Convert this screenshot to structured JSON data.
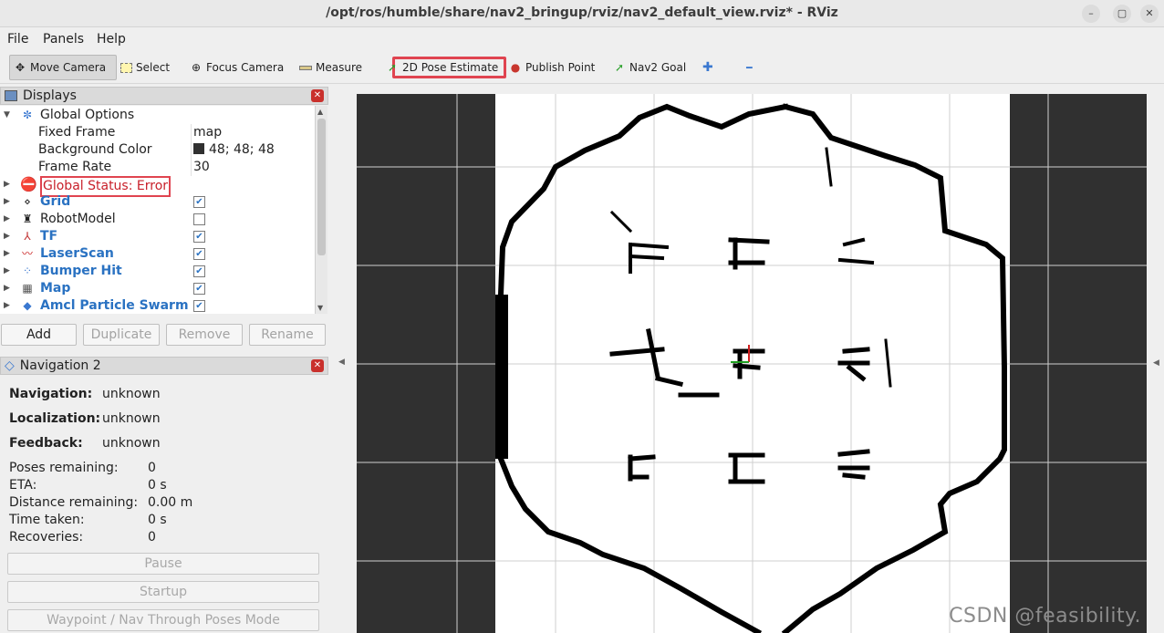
{
  "window": {
    "title": "/opt/ros/humble/share/nav2_bringup/rviz/nav2_default_view.rviz* - RViz",
    "minimize_glyph": "–",
    "maximize_glyph": "▢",
    "close_glyph": "✕"
  },
  "menu": {
    "items": [
      "File",
      "Panels",
      "Help"
    ]
  },
  "toolbar": {
    "move_camera": "Move Camera",
    "select": "Select",
    "focus_camera": "Focus Camera",
    "measure": "Measure",
    "pose_estimate": "2D Pose Estimate",
    "publish_point": "Publish Point",
    "nav2_goal": "Nav2 Goal",
    "add_glyph": "✚",
    "remove_glyph": "━"
  },
  "displays": {
    "title": "Displays",
    "global_options": "Global Options",
    "fixed_frame_label": "Fixed Frame",
    "fixed_frame_value": "map",
    "bg_color_label": "Background Color",
    "bg_color_value": "48; 48; 48",
    "bg_color_hex": "#303030",
    "frame_rate_label": "Frame Rate",
    "frame_rate_value": "30",
    "global_status": "Global Status: Error",
    "items": [
      {
        "name": "Grid",
        "checked": true,
        "icon": "grid-icon"
      },
      {
        "name": "RobotModel",
        "checked": false,
        "icon": "robot-icon"
      },
      {
        "name": "TF",
        "checked": true,
        "icon": "tf-icon"
      },
      {
        "name": "LaserScan",
        "checked": true,
        "icon": "laserscan-icon"
      },
      {
        "name": "Bumper Hit",
        "checked": true,
        "icon": "bumper-icon"
      },
      {
        "name": "Map",
        "checked": true,
        "icon": "map-icon"
      },
      {
        "name": "Amcl Particle Swarm",
        "checked": true,
        "icon": "particle-icon"
      }
    ],
    "buttons": {
      "add": "Add",
      "duplicate": "Duplicate",
      "remove": "Remove",
      "rename": "Rename"
    }
  },
  "navigation": {
    "title": "Navigation 2",
    "navigation_label": "Navigation:",
    "navigation_value": "unknown",
    "localization_label": "Localization:",
    "localization_value": "unknown",
    "feedback_label": "Feedback:",
    "feedback_value": "unknown",
    "poses_label": "Poses remaining:",
    "poses_value": "0",
    "eta_label": "ETA:",
    "eta_value": "0 s",
    "distance_label": "Distance remaining:",
    "distance_value": "0.00 m",
    "time_label": "Time taken:",
    "time_value": "0 s",
    "recoveries_label": "Recoveries:",
    "recoveries_value": "0",
    "pause": "Pause",
    "startup": "Startup",
    "waypoint": "Waypoint / Nav Through Poses Mode"
  },
  "viewport": {
    "watermark": "CSDN @feasibility."
  }
}
